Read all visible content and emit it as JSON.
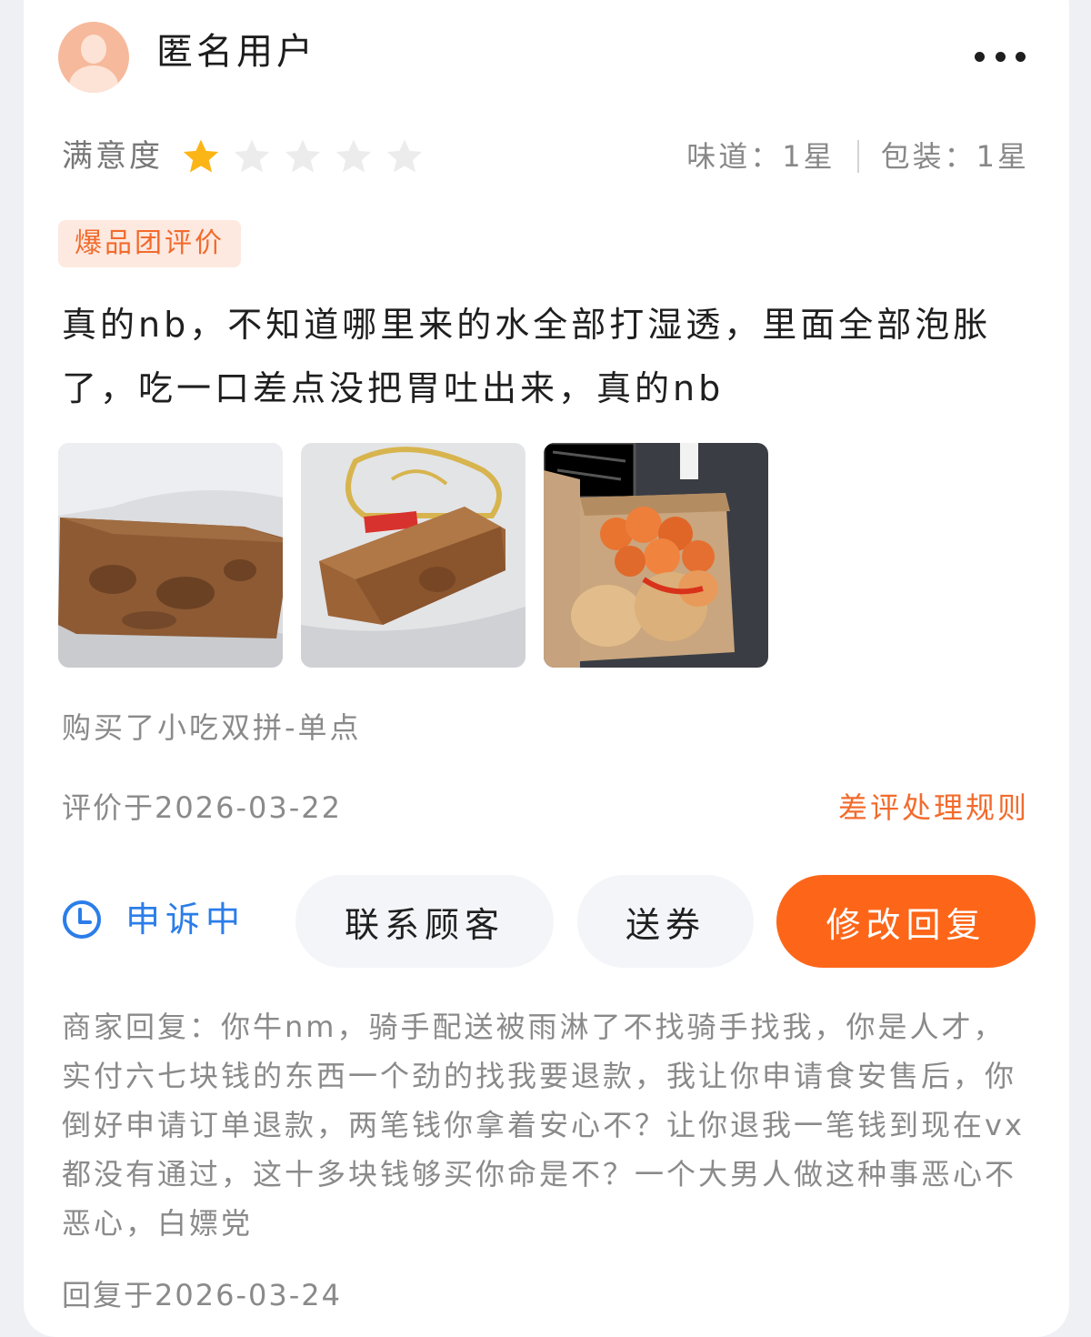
{
  "user": {
    "name": "匿名用户"
  },
  "rating": {
    "satisfaction_label": "满意度",
    "stars_filled": 1,
    "stars_total": 5,
    "taste": "味道：1星",
    "packaging": "包装：1星",
    "star_color": "#fbb516",
    "star_empty_color": "#ececec"
  },
  "tag": "爆品团评价",
  "review": {
    "text": "真的nb，不知道哪里来的水全部打湿透，里面全部泡胀了，吃一口差点没把胃吐出来，真的nb",
    "photos": [
      "box-photo-1",
      "box-photo-2",
      "fried-chicken-photo"
    ],
    "purchase": "购买了小吃双拼-单点",
    "date": "评价于2026-03-22",
    "rules_link": "差评处理规则"
  },
  "actions": {
    "appeal_status": "申诉中",
    "contact": "联系顾客",
    "coupon": "送券",
    "edit_reply": "修改回复"
  },
  "merchant_reply": {
    "text": "商家回复：你牛nm，骑手配送被雨淋了不找骑手找我，你是人才，实付六七块钱的东西一个劲的找我要退款，我让你申请食安售后，你倒好申请订单退款，两笔钱你拿着安心不？让你退我一笔钱到现在vx都没有通过，这十多块钱够买你命是不？一个大男人做这种事恶心不恶心，白嫖党",
    "date": "回复于2026-03-24"
  },
  "colors": {
    "accent": "#fd6619",
    "link": "#f26b2d",
    "appeal": "#2b7de9"
  }
}
